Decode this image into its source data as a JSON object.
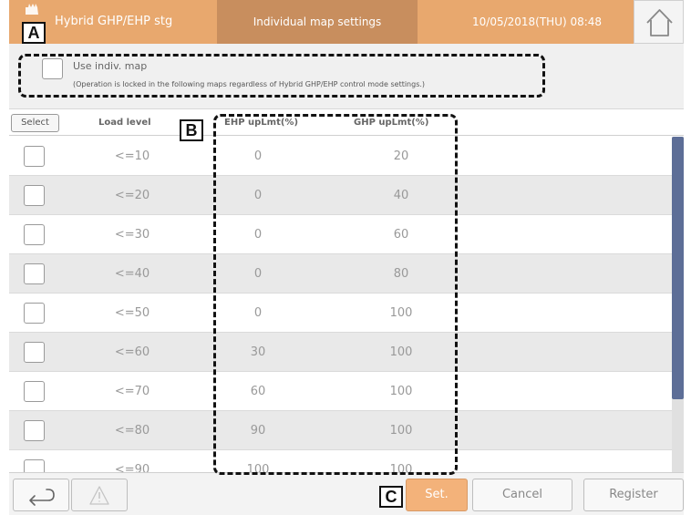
{
  "header": {
    "title": "Hybrid GHP/EHP stg",
    "page_name": "Individual map settings",
    "datetime": "10/05/2018(THU) 08:48",
    "home_icon": "home-icon"
  },
  "callouts": {
    "a": "A",
    "b": "B",
    "c": "C"
  },
  "use_map": {
    "label": "Use indiv. map",
    "note": "(Operation is locked in the following maps regardless of Hybrid GHP/EHP control mode settings.)",
    "checked": false
  },
  "table": {
    "select_label": "Select",
    "columns": {
      "load": "Load level",
      "ehp": "EHP upLmt(%)",
      "ghp": "GHP upLmt(%)"
    },
    "rows": [
      {
        "load": "<=10",
        "ehp": "0",
        "ghp": "20"
      },
      {
        "load": "<=20",
        "ehp": "0",
        "ghp": "40"
      },
      {
        "load": "<=30",
        "ehp": "0",
        "ghp": "60"
      },
      {
        "load": "<=40",
        "ehp": "0",
        "ghp": "80"
      },
      {
        "load": "<=50",
        "ehp": "0",
        "ghp": "100"
      },
      {
        "load": "<=60",
        "ehp": "30",
        "ghp": "100"
      },
      {
        "load": "<=70",
        "ehp": "60",
        "ghp": "100"
      },
      {
        "load": "<=80",
        "ehp": "90",
        "ghp": "100"
      },
      {
        "load": "<=90",
        "ehp": "100",
        "ghp": "100"
      }
    ]
  },
  "footer": {
    "back_icon": "back-arrow-icon",
    "warning_icon": "warning-icon",
    "set_label": "Set.",
    "cancel_label": "Cancel",
    "register_label": "Register"
  },
  "colors": {
    "header": "#e8a86e",
    "header_center": "#c88e5e",
    "set_button": "#f3b27a",
    "scroll_thumb": "#5d6e97"
  }
}
